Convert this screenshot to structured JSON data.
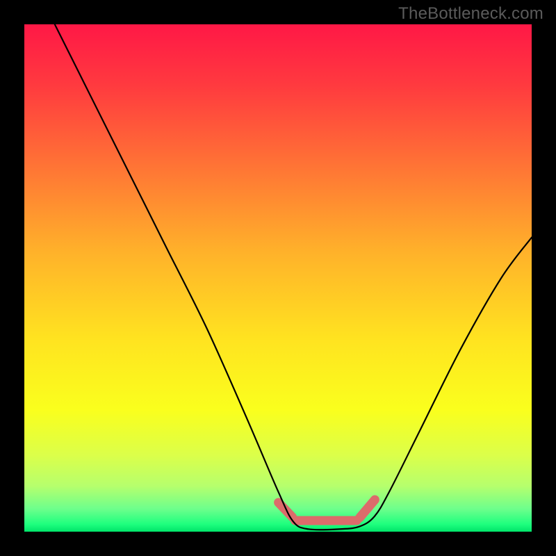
{
  "watermark": "TheBottleneck.com",
  "chart_data": {
    "type": "line",
    "title": "",
    "xlabel": "",
    "ylabel": "",
    "xlim": [
      0,
      100
    ],
    "ylim": [
      0,
      100
    ],
    "grid": false,
    "legend": false,
    "gradient": {
      "stops": [
        {
          "offset": 0,
          "color": "#ff1846"
        },
        {
          "offset": 12,
          "color": "#ff3a3f"
        },
        {
          "offset": 28,
          "color": "#ff7435"
        },
        {
          "offset": 45,
          "color": "#ffb22a"
        },
        {
          "offset": 62,
          "color": "#ffe320"
        },
        {
          "offset": 76,
          "color": "#faff1d"
        },
        {
          "offset": 85,
          "color": "#dbff4a"
        },
        {
          "offset": 91,
          "color": "#b6ff6d"
        },
        {
          "offset": 95.5,
          "color": "#6dff8c"
        },
        {
          "offset": 98.5,
          "color": "#1fff7e"
        },
        {
          "offset": 100,
          "color": "#00e46a"
        }
      ]
    },
    "trough_band": {
      "x_start": 52,
      "x_end": 68,
      "color": "#dc6b6b",
      "y": 97.5
    },
    "series": [
      {
        "name": "bottleneck-curve",
        "color": "#000000",
        "points": [
          {
            "x": 6,
            "y": 100
          },
          {
            "x": 12,
            "y": 88
          },
          {
            "x": 20,
            "y": 72
          },
          {
            "x": 28,
            "y": 56
          },
          {
            "x": 36,
            "y": 40
          },
          {
            "x": 44,
            "y": 22
          },
          {
            "x": 50,
            "y": 8
          },
          {
            "x": 53,
            "y": 2
          },
          {
            "x": 56,
            "y": 0.5
          },
          {
            "x": 62,
            "y": 0.5
          },
          {
            "x": 66,
            "y": 1
          },
          {
            "x": 69,
            "y": 3
          },
          {
            "x": 72,
            "y": 8
          },
          {
            "x": 78,
            "y": 20
          },
          {
            "x": 86,
            "y": 36
          },
          {
            "x": 94,
            "y": 50
          },
          {
            "x": 100,
            "y": 58
          }
        ]
      }
    ]
  }
}
